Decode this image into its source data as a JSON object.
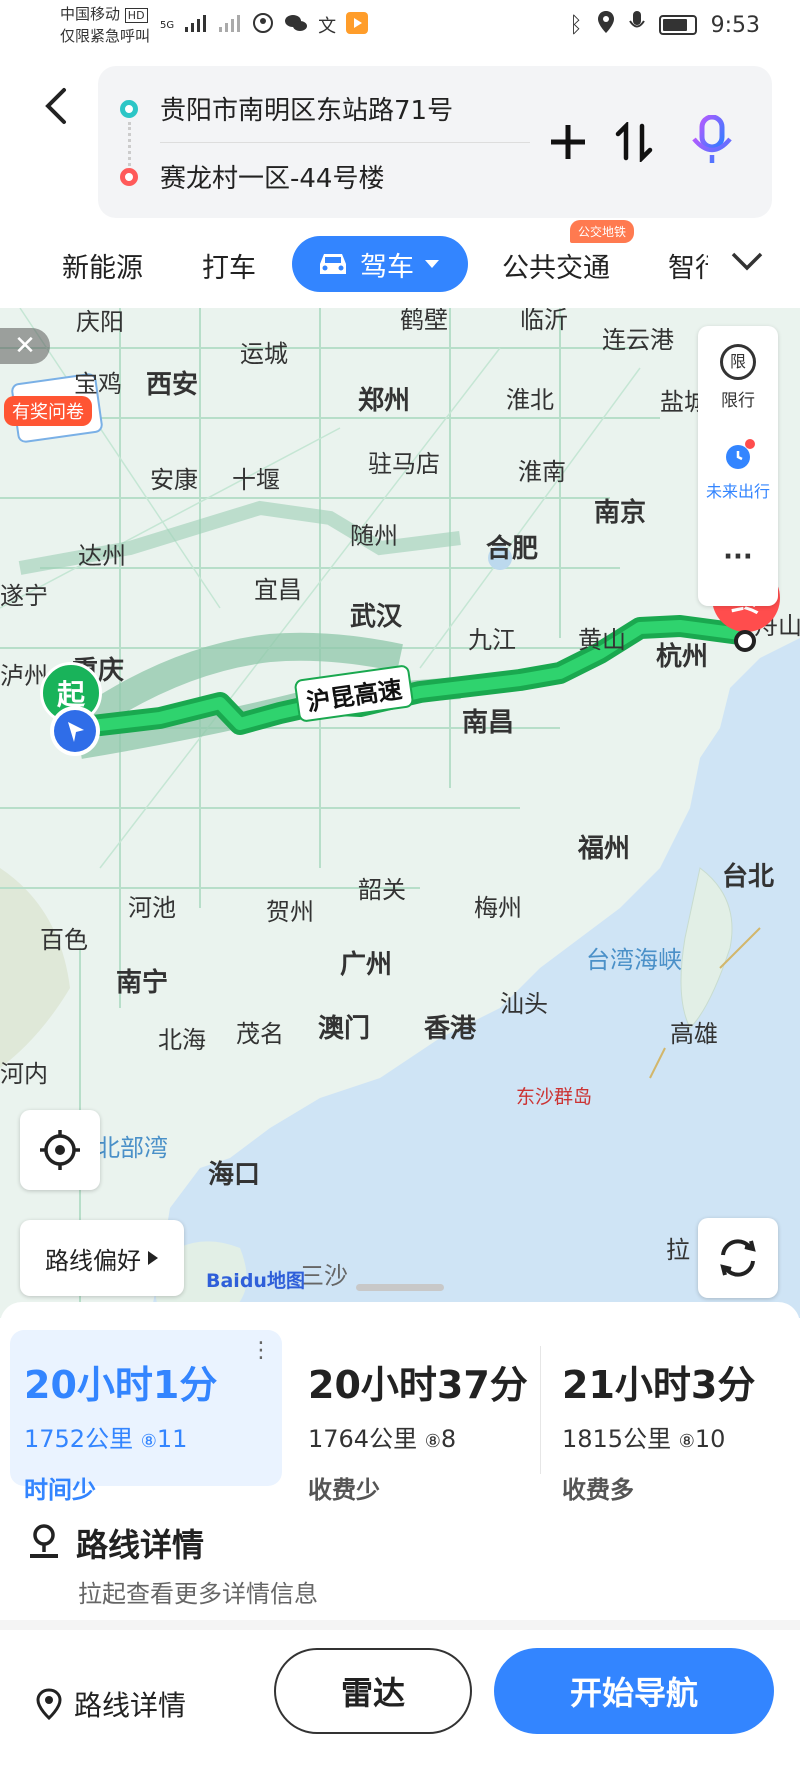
{
  "status": {
    "carrier": "中国移动",
    "hd": "HD",
    "emergency": "仅限紧急呼叫",
    "net": "5G",
    "time": "9:53"
  },
  "search": {
    "origin": "贵阳市南明区东站路71号",
    "destination": "赛龙村一区-44号楼"
  },
  "tabs": {
    "t1": "新能源",
    "t2": "打车",
    "active": "驾车",
    "t4": "公共交通",
    "t5": "智行",
    "badge": "公交地铁"
  },
  "map": {
    "close": "✕",
    "survey": "有奖问卷",
    "limit": "限行",
    "limit_icon": "限",
    "future": "未来出行",
    "more": "···",
    "start": "起",
    "end": "终",
    "road": "沪昆高速",
    "pref": "路线偏好",
    "brand": "Baidu地图",
    "cities": {
      "anyang": "庆阳",
      "yuncheng": "运城",
      "hebi": "鹤壁",
      "linyi": "临沂",
      "baoji": "宝鸡",
      "xian": "西安",
      "zhengzhou": "郑州",
      "huaibei": "淮北",
      "lianyungang": "连云港",
      "zhumadian": "驻马店",
      "yancheng": "盐城",
      "ankang": "安康",
      "shiyan": "十堰",
      "huainan": "淮南",
      "nanjing": "南京",
      "suizhou": "随州",
      "hefei": "合肥",
      "dazhou": "达州",
      "suining": "遂宁",
      "yichang": "宜昌",
      "wuhan": "武汉",
      "jiujiang": "九江",
      "huangshan": "黄山",
      "hangzhou": "杭州",
      "zhoushan": "舟山",
      "chongqing": "重庆",
      "luzhou": "泸州",
      "nanchang": "南昌",
      "fuzhou": "福州",
      "taibei": "台北",
      "hechi": "河池",
      "hezhou": "贺州",
      "shaoguan": "韶关",
      "meizhou": "梅州",
      "taiwan": "台湾海峡",
      "baise": "百色",
      "nanning": "南宁",
      "guangzhou": "广州",
      "shantou": "汕头",
      "gaoxiong": "高雄",
      "beihai": "北海",
      "maoming": "茂名",
      "macau": "澳门",
      "hongkong": "香港",
      "hanoi": "河内",
      "dongsha": "东沙群岛",
      "beibuwan": "北部湾",
      "haikou": "海口",
      "sansha": "三沙",
      "la": "拉"
    }
  },
  "routes": [
    {
      "time": "20小时1分",
      "dist": "1752公里",
      "lights": "11",
      "tag": "时间少"
    },
    {
      "time": "20小时37分",
      "dist": "1764公里",
      "lights": "8",
      "tag": "收费少"
    },
    {
      "time": "21小时3分",
      "dist": "1815公里",
      "lights": "10",
      "tag": "收费多"
    }
  ],
  "detail": {
    "title": "路线详情",
    "subtitle": "拉起查看更多详情信息"
  },
  "footer": {
    "detail": "路线详情",
    "radar": "雷达",
    "navigate": "开始导航"
  },
  "colors": {
    "accent": "#3385ff",
    "route": "#1db954",
    "end": "#ff4d4d"
  }
}
